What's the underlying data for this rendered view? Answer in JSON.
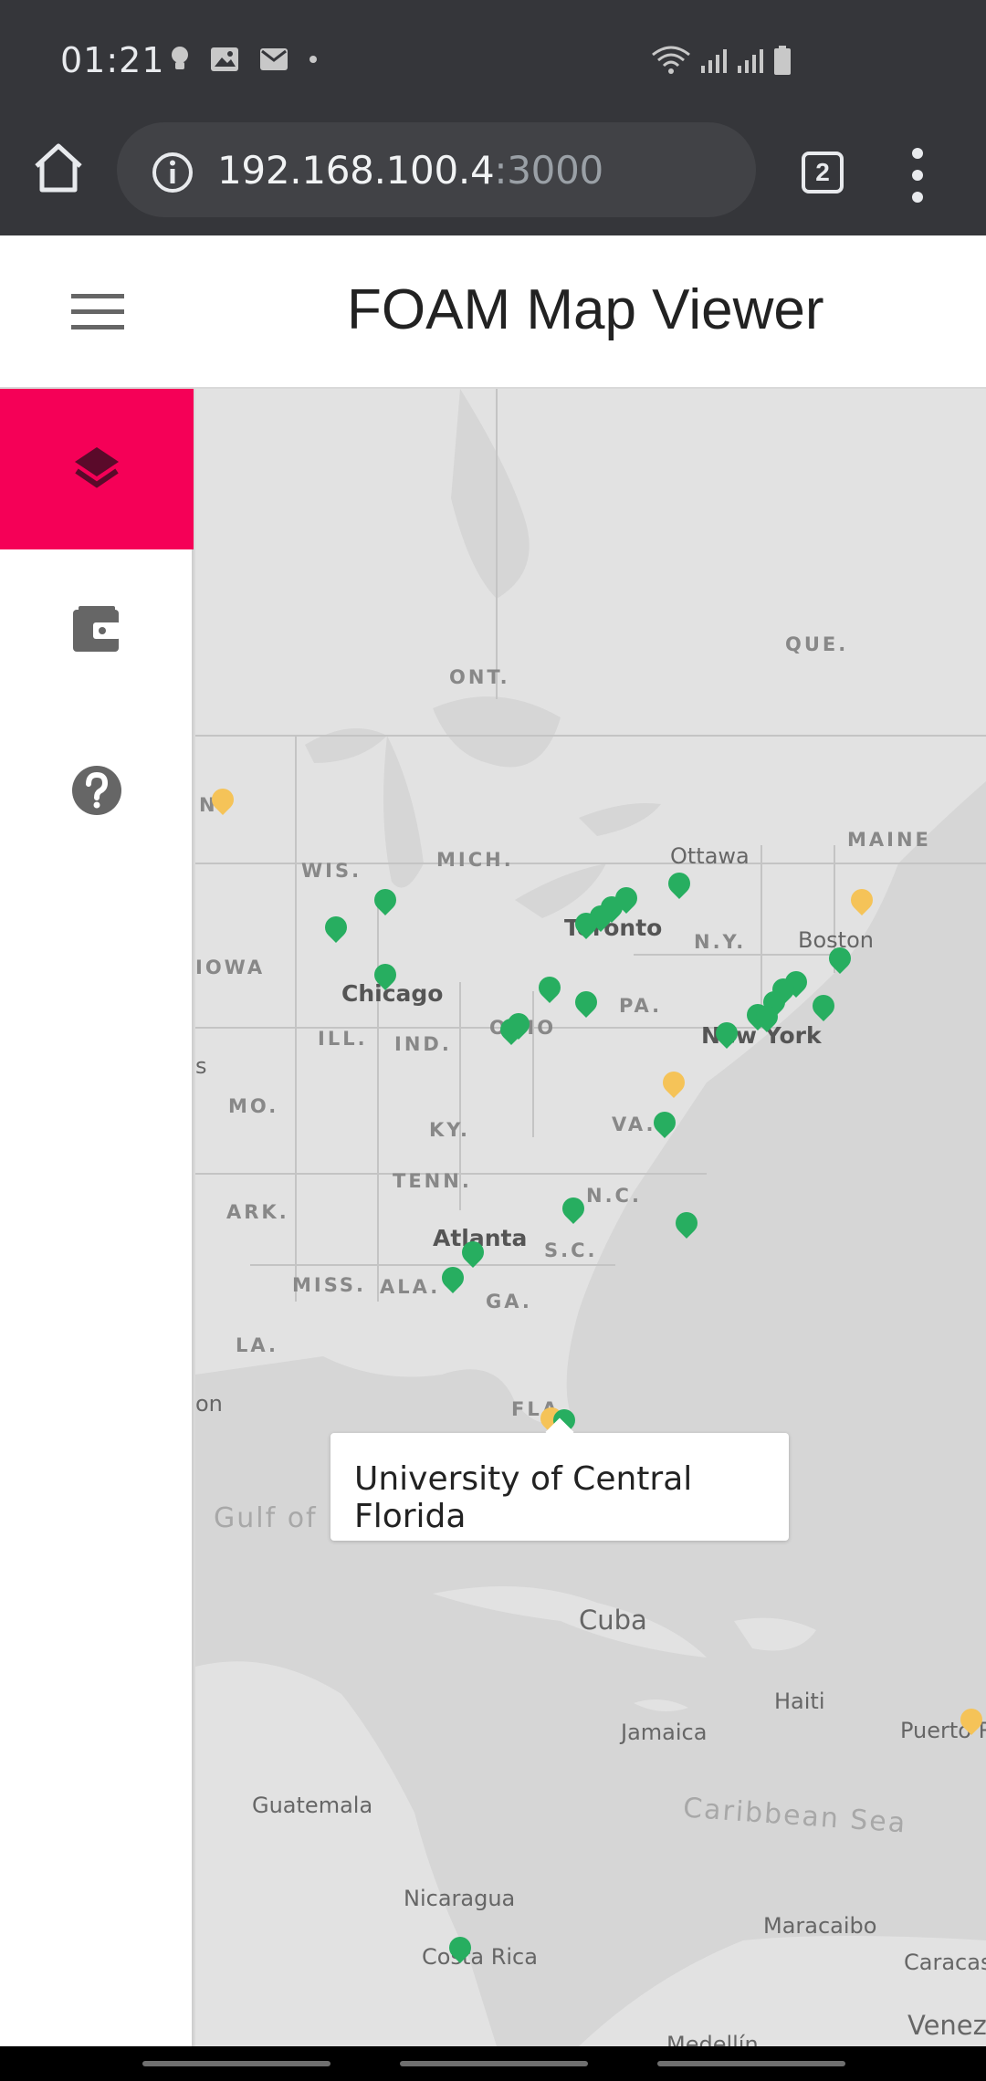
{
  "status_bar": {
    "time": "01:21"
  },
  "browser": {
    "url_host": "192.168.100.4",
    "url_port": ":3000",
    "tab_count": "2"
  },
  "app": {
    "title": "FOAM Map Viewer"
  },
  "side_rail": {
    "items": [
      {
        "name": "layers",
        "active": true
      },
      {
        "name": "wallet",
        "active": false
      },
      {
        "name": "help",
        "active": false
      }
    ]
  },
  "map": {
    "labels": {
      "ont": "ONT.",
      "que": "QUE.",
      "maine": "MAINE",
      "ottawa": "Ottawa",
      "toronto": "Toronto",
      "ny": "N.Y.",
      "boston": "Boston",
      "mich": "MICH.",
      "wis": "WIS.",
      "mn": "N.",
      "iowa": "IOWA",
      "chicago": "Chicago",
      "ill": "ILL.",
      "ind": "IND.",
      "ohio": "OHIO",
      "pa": "PA.",
      "new_york": "New York",
      "mo": "MO.",
      "ky": "KY.",
      "va": "VA.",
      "tenn": "TENN.",
      "nc": "N.C.",
      "ark": "ARK.",
      "atlanta": "Atlanta",
      "sc": "S.C.",
      "miss": "MISS.",
      "ala": "ALA.",
      "ga": "GA.",
      "la": "LA.",
      "on": "on",
      "fla": "FLA.",
      "gulf": "Gulf of",
      "cuba": "Cuba",
      "haiti": "Haiti",
      "jamaica": "Jamaica",
      "puerto": "Puerto R",
      "guatemala": "Guatemala",
      "caribbean": "Caribbean Sea",
      "nicaragua": "Nicaragua",
      "costa_rica": "Costa Rica",
      "maracaibo": "Maracaibo",
      "caracas": "Caracas",
      "medellin": "Medellín",
      "venez": "Venez",
      "s_edge": "s"
    },
    "tooltip": "University of Central Florida",
    "pin_colors": {
      "green": "#27ae60",
      "yellow": "#f5c358"
    }
  },
  "colors": {
    "accent": "#f50057",
    "chrome": "#35363a"
  }
}
